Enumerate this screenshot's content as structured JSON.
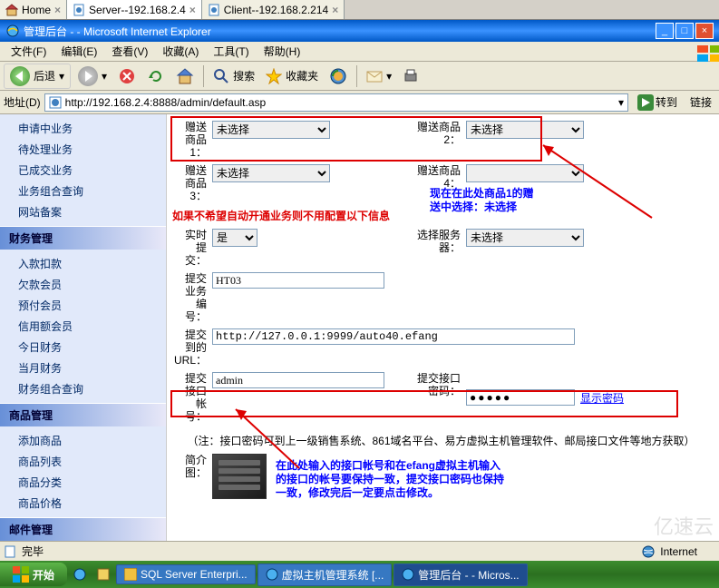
{
  "tabs": [
    {
      "label": "Home",
      "icon": "home"
    },
    {
      "label": "Server--192.168.2.4",
      "icon": "page",
      "active": true
    },
    {
      "label": "Client--192.168.2.214",
      "icon": "page"
    }
  ],
  "window_title": "管理后台 - - Microsoft Internet Explorer",
  "menu": [
    "文件(F)",
    "编辑(E)",
    "查看(V)",
    "收藏(A)",
    "工具(T)",
    "帮助(H)"
  ],
  "toolbar": {
    "back": "后退",
    "search": "搜索",
    "favorites": "收藏夹"
  },
  "address_label": "地址(D)",
  "url": "http://192.168.2.4:8888/admin/default.asp",
  "go": "转到",
  "links": "链接",
  "sidebar": {
    "group0_items": [
      "申请中业务",
      "待处理业务",
      "已成交业务",
      "业务组合查询",
      "网站备案"
    ],
    "group1": "财务管理",
    "group1_items": [
      "入款扣款",
      "欠款会员",
      "预付会员",
      "信用额会员",
      "今日财务",
      "当月财务",
      "财务组合查询"
    ],
    "group2": "商品管理",
    "group2_items": [
      "添加商品",
      "商品列表",
      "商品分类",
      "商品价格"
    ],
    "group3": "邮件管理"
  },
  "form": {
    "gift_product1_label": "赠送\n商品\n1：",
    "gift_product1_value": "未选择",
    "gift_product2_label": "赠送商品\n2：",
    "gift_product2_value": "未选择",
    "gift_product3_label": "赠送\n商品\n3：",
    "gift_product3_value": "未选择",
    "gift_product4_label": "赠送商品\n4：",
    "gift_product4_value": "",
    "warning_text": "如果不希望自动开通业务则不用配置以下信息",
    "realtime_label": "实时\n提\n交：",
    "realtime_value": "是",
    "server_select_label": "选择服务\n器：",
    "server_select_value": "未选择",
    "biz_code_label": "提交\n业务\n编\n号：",
    "biz_code_value": "HT03",
    "submit_url_label": "提交\n到的\nURL：",
    "submit_url_value": "http://127.0.0.1:9999/auto40.efang",
    "api_account_label": "提交\n接口\n帐\n号：",
    "api_account_value": "admin",
    "api_password_label": "提交接口\n密码：",
    "api_password_value": "●●●●●",
    "show_password": "显示密码",
    "note": "（注：接口密码可到上一级销售系统、861域名平台、易方虚拟主机管理软件、邮局接口文件等地方获取）",
    "intro_label": "简介\n图：",
    "annotation1": "现在在此处商品1的赠\n送中选择：未选择",
    "annotation2": "在此处输入的接口帐号和在efang虚拟主机输入\n的接口的帐号要保持一致，提交接口密码也保持\n一致，修改完后一定要点击修改。"
  },
  "statusbar": {
    "done": "完毕",
    "zone": "Internet"
  },
  "taskbar": {
    "start": "开始",
    "tasks": [
      "SQL Server Enterpri...",
      "虚拟主机管理系统 [...",
      "管理后台 - - Micros..."
    ]
  },
  "watermark": "亿速云"
}
